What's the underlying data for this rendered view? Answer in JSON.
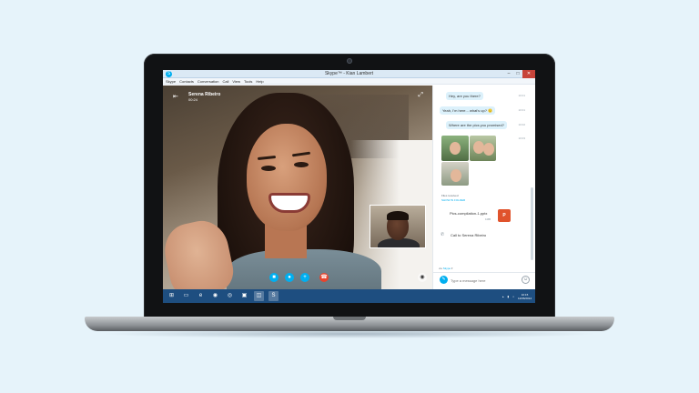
{
  "window": {
    "title": "Skype™ - Kian Lambert",
    "minimize": "–",
    "maximize": "□",
    "close": "✕"
  },
  "menu": [
    "Skype",
    "Contacts",
    "Conversation",
    "Call",
    "View",
    "Tools",
    "Help"
  ],
  "call": {
    "contact_name": "Serena Ribeiro",
    "duration": "00:24",
    "controls": [
      {
        "name": "video-icon",
        "glyph": "■"
      },
      {
        "name": "microphone-icon",
        "glyph": "●"
      },
      {
        "name": "add-icon",
        "glyph": "+"
      },
      {
        "name": "end-call-icon",
        "glyph": "☎"
      }
    ]
  },
  "chat": {
    "messages": [
      {
        "text": "Hey, are you there?",
        "time": "10:01"
      },
      {
        "text": "Yeah, I'm here... what's up? 🙂",
        "time": "10:01"
      },
      {
        "text": "Where are the pics you promised?",
        "time": "10:02"
      }
    ],
    "photos_time": "10:03",
    "file_received": "Files received",
    "show_in_folder": "SHOW IN FOLDER",
    "file": {
      "name": "Pics-compilation-1.pptx",
      "size": "1MB",
      "icon": "P"
    },
    "call_entry": "Call to Serena Ribeiro",
    "via_label": "via",
    "via_value": "Skype",
    "compose_placeholder": "Type a message here"
  },
  "taskbar": {
    "apps": [
      {
        "name": "start-icon",
        "glyph": "⊞"
      },
      {
        "name": "file-explorer-icon",
        "glyph": "▭"
      },
      {
        "name": "internet-explorer-icon",
        "glyph": "e"
      },
      {
        "name": "firefox-icon",
        "glyph": "◉"
      },
      {
        "name": "chrome-icon",
        "glyph": "◎"
      },
      {
        "name": "store-icon",
        "glyph": "▣"
      },
      {
        "name": "outlook-icon",
        "glyph": "◫"
      },
      {
        "name": "skype-icon",
        "glyph": "S"
      }
    ],
    "time": "10:15",
    "date": "12/06/2014"
  },
  "colors": {
    "accent": "#00aff0",
    "end_call": "#e8442d",
    "taskbar": "#1e4e80",
    "bubble": "#dcf1fb"
  }
}
